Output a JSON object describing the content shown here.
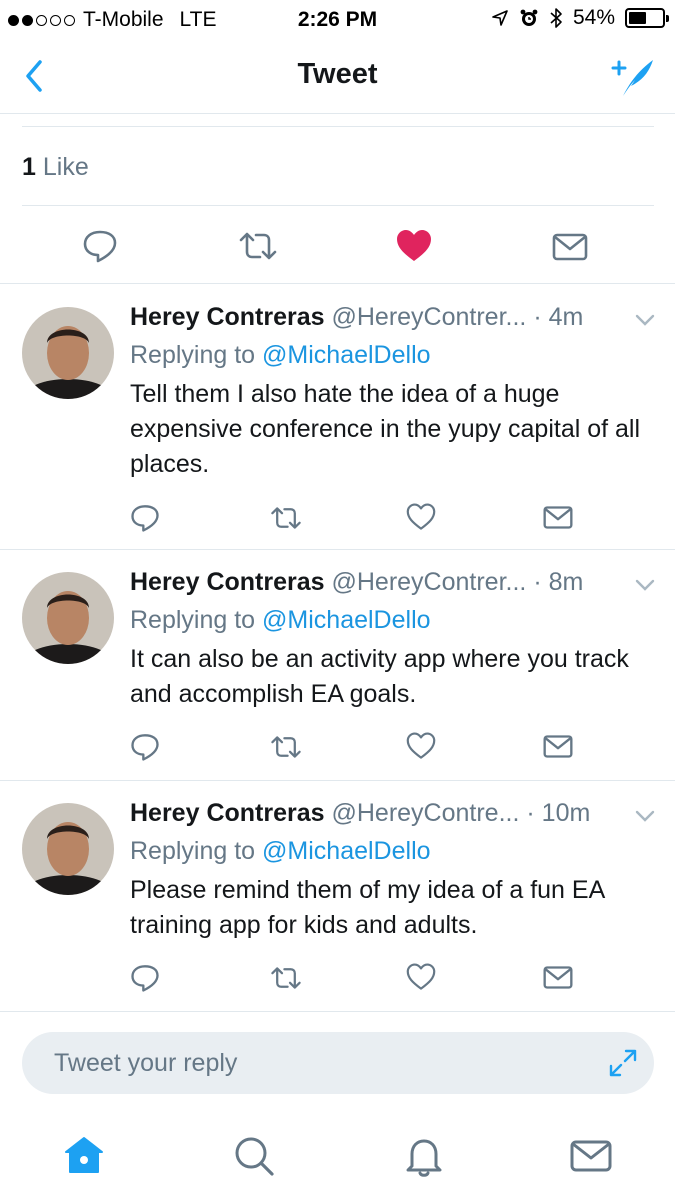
{
  "status_bar": {
    "carrier": "T-Mobile",
    "network": "LTE",
    "time": "2:26 PM",
    "battery_percent": "54%",
    "battery_level": 0.54
  },
  "nav": {
    "title": "Tweet"
  },
  "likes": {
    "count": "1",
    "label": "Like"
  },
  "main_tweet_actions": {
    "liked": true,
    "like_color": "#e0245e"
  },
  "replies": [
    {
      "name": "Herey Contreras",
      "handle": "@HereyContrer...",
      "time": "· 4m",
      "replying_prefix": "Replying to",
      "replying_to": "@MichaelDello",
      "text": "Tell them I also hate the idea of a huge expensive conference in the yupy capital of all places."
    },
    {
      "name": "Herey Contreras",
      "handle": "@HereyContrer...",
      "time": "· 8m",
      "replying_prefix": "Replying to",
      "replying_to": "@MichaelDello",
      "text": "It can also be an activity app where you track and accomplish EA goals."
    },
    {
      "name": "Herey Contreras",
      "handle": "@HereyContre...",
      "time": "· 10m",
      "replying_prefix": "Replying to",
      "replying_to": "@MichaelDello",
      "text": "Please remind them of my idea of a fun EA training app for kids and adults."
    }
  ],
  "reply_box": {
    "placeholder": "Tweet your reply"
  },
  "tab_bar": {
    "items": [
      "home-icon",
      "search-icon",
      "notifications-icon",
      "messages-icon"
    ],
    "active": "home-icon"
  },
  "colors": {
    "accent": "#1da1f2",
    "mention": "#1b95e0",
    "secondary_text": "#657786",
    "icon_gray": "#657786",
    "like_red": "#e0245e"
  }
}
